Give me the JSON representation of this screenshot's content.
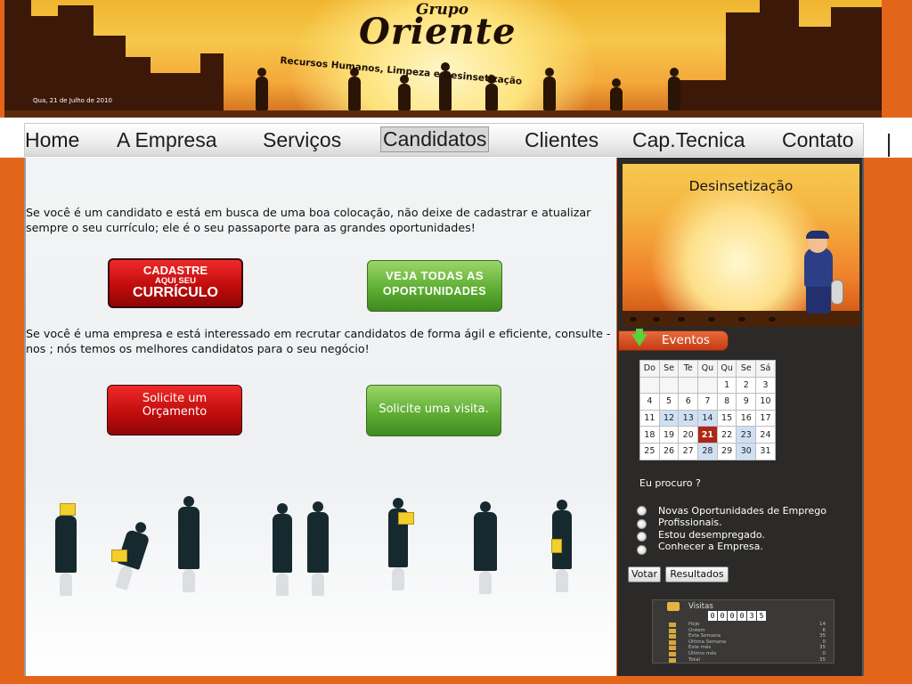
{
  "header": {
    "brand_sup": "Grupo",
    "brand_name": "Oriente",
    "tagline": "Recursos Humanos, Limpeza e Desinsetização",
    "date": "Qua, 21 de Julho de 2010"
  },
  "nav": {
    "items": [
      {
        "label": "Home"
      },
      {
        "label": "A Empresa"
      },
      {
        "label": "Serviços"
      },
      {
        "label": "Candidatos",
        "active": true
      },
      {
        "label": "Clientes"
      },
      {
        "label": "Cap.Tecnica"
      },
      {
        "label": "Contato"
      }
    ]
  },
  "main": {
    "para1": "Se você é um candidato e está em busca de uma boa colocação, não deixe de cadastrar e atualizar sempre o seu currículo; ele é o seu passaporte para as grandes oportunidades!",
    "btn_cadastre_line1": "CADASTRE",
    "btn_cadastre_line2": "AQUI SEU",
    "btn_cadastre_line3": "CURRÍCULO",
    "btn_veja_line1": "VEJA TODAS AS",
    "btn_veja_line2": "OPORTUNIDADES",
    "para2": "Se você é uma empresa e está interessado em recrutar candidatos de forma ágil e eficiente, consulte -nos ; nós temos os melhores candidatos para o seu negócio!",
    "btn_orcamento_line1": "Solicite um",
    "btn_orcamento_line2": "Orçamento",
    "btn_visita": "Solicite uma visita."
  },
  "sidebar": {
    "promo_title": "Desinsetização",
    "events_label": "Eventos",
    "calendar": {
      "weekdays": [
        "Do",
        "Se",
        "Te",
        "Qu",
        "Qu",
        "Se",
        "Sá"
      ],
      "weeks": [
        [
          "",
          "",
          "",
          "",
          "1",
          "2",
          "3"
        ],
        [
          "4",
          "5",
          "6",
          "7",
          "8",
          "9",
          "10"
        ],
        [
          "11",
          "12",
          "13",
          "14",
          "15",
          "16",
          "17"
        ],
        [
          "18",
          "19",
          "20",
          "21",
          "22",
          "23",
          "24"
        ],
        [
          "25",
          "26",
          "27",
          "28",
          "29",
          "30",
          "31"
        ]
      ],
      "highlighted": [
        "12",
        "13",
        "14",
        "23",
        "28",
        "30"
      ],
      "today": "21"
    },
    "poll": {
      "question": "Eu procuro ?",
      "options": [
        "Novas Oportunidades de Emprego",
        "Profissionais.",
        "Estou desempregado.",
        "Conhecer a Empresa."
      ],
      "vote_label": "Votar",
      "results_label": "Resultados"
    },
    "visits": {
      "title": "Visitas",
      "counter": "000035",
      "rows": [
        {
          "label": "Hoje",
          "value": "14"
        },
        {
          "label": "Ontem",
          "value": "6"
        },
        {
          "label": "Esta Semana",
          "value": "35"
        },
        {
          "label": "Última Semana",
          "value": "0"
        },
        {
          "label": "Este mês",
          "value": "35"
        },
        {
          "label": "Último mês",
          "value": "0"
        },
        {
          "label": "Total",
          "value": "35"
        }
      ]
    }
  },
  "colors": {
    "background_orange": "#e2651a",
    "sidebar_dark": "#2b2a28",
    "button_red": "#c20c0c",
    "button_green": "#5fae34",
    "today_red": "#b02616"
  }
}
